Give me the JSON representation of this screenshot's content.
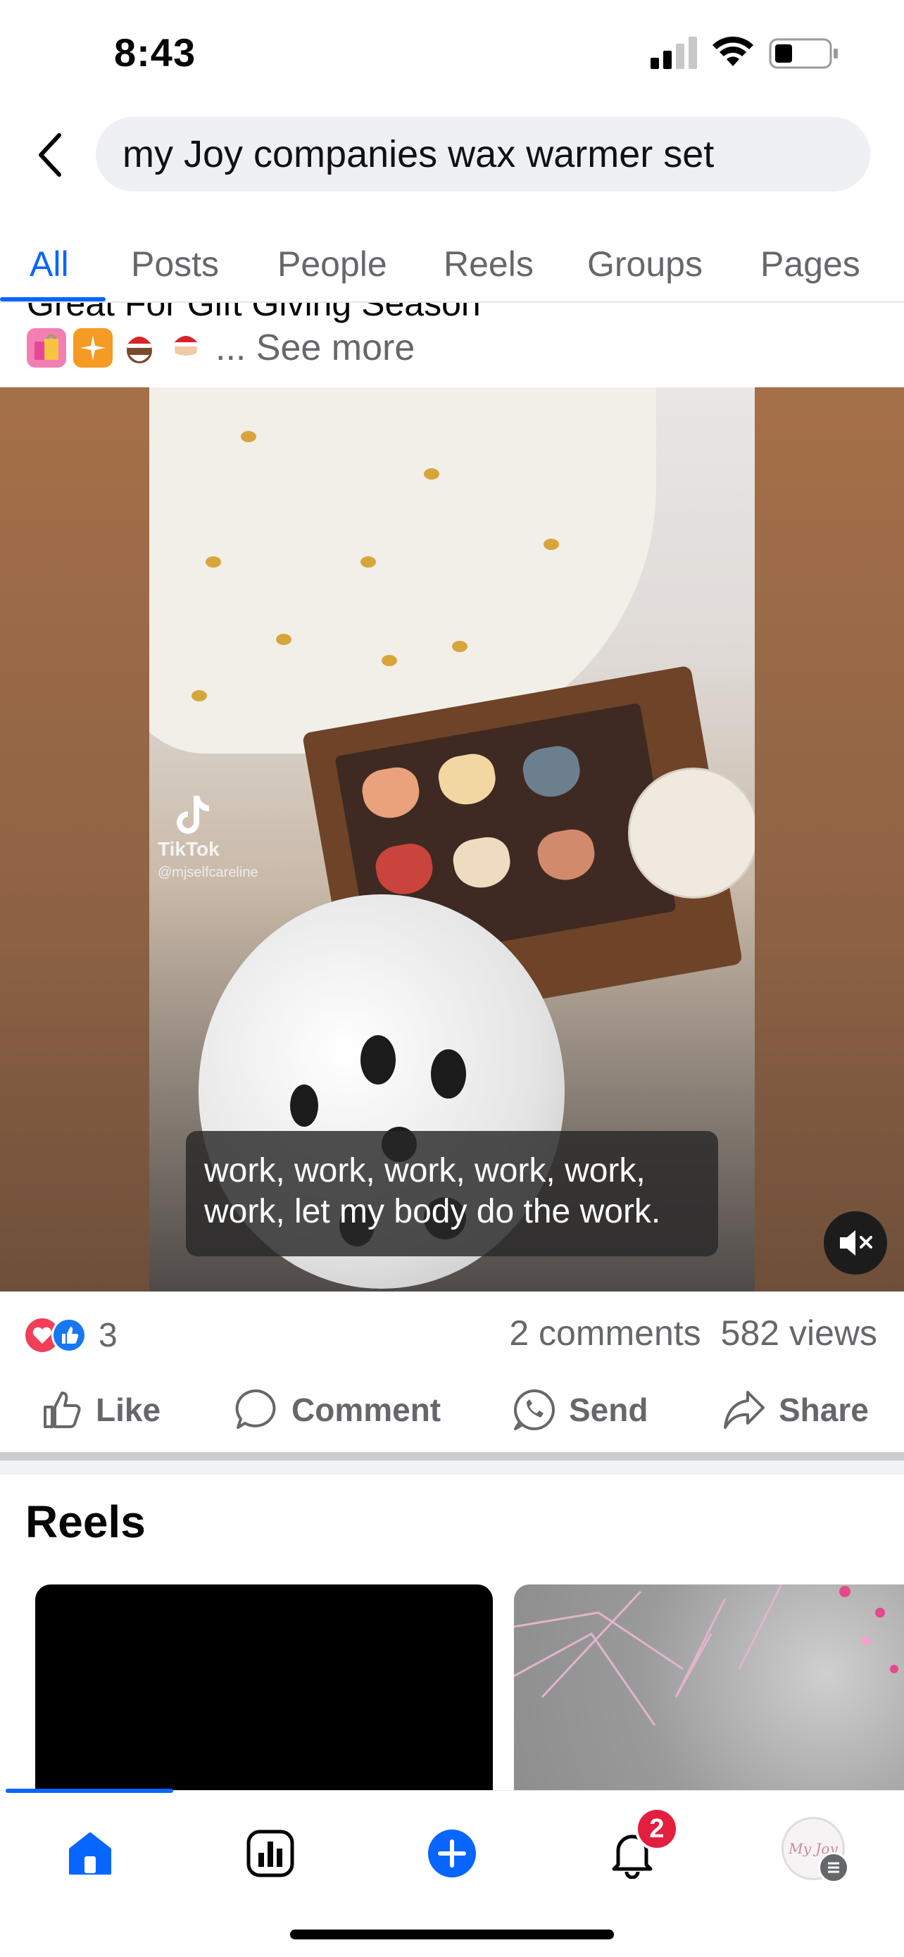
{
  "status_bar": {
    "time": "8:43"
  },
  "header": {
    "search_query": "my Joy companies wax warmer set"
  },
  "tabs": [
    {
      "label": "All",
      "active": true
    },
    {
      "label": "Posts"
    },
    {
      "label": "People"
    },
    {
      "label": "Reels"
    },
    {
      "label": "Groups"
    },
    {
      "label": "Pages"
    }
  ],
  "post": {
    "text_partial": "Great For Gift Giving Season",
    "emojis": [
      "shopping-bags-emoji",
      "sparkle-emoji",
      "santa-emoji",
      "santa-emoji"
    ],
    "see_more": "... See more",
    "video": {
      "watermark_brand": "TikTok",
      "watermark_user": "@mjselfcareline",
      "caption_line1": "work, work, work, work, work,",
      "caption_line2": "work, let my body do the work.",
      "muted": true
    },
    "reactions_count": "3",
    "comments": "2 comments",
    "views": "582 views",
    "actions": {
      "like": "Like",
      "comment": "Comment",
      "send": "Send",
      "share": "Share"
    }
  },
  "reels_section": {
    "title": "Reels"
  },
  "bottom_nav": {
    "items": [
      "home-icon",
      "dashboard-icon",
      "create-icon",
      "notifications-icon",
      "profile-menu"
    ],
    "notifications_badge": "2",
    "avatar_text": "My Joy"
  },
  "colors": {
    "accent": "#0866ff",
    "badge": "#e41e3f",
    "muted_text": "#65676b"
  }
}
